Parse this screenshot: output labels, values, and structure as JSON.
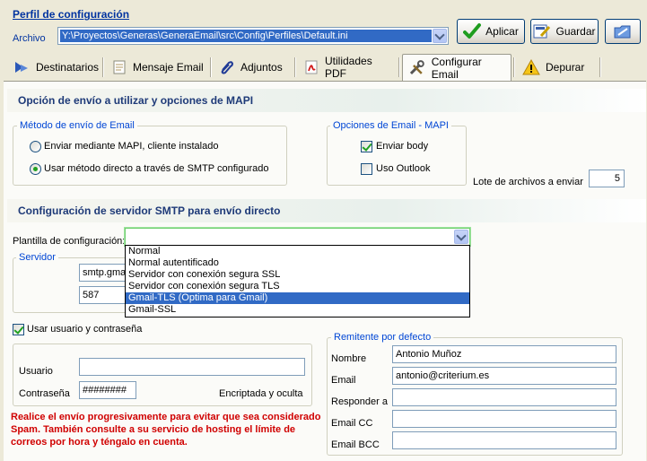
{
  "profile": {
    "title_first": "P",
    "title_rest": "erfil de configuración",
    "archivo_label": "Archivo",
    "file_path": "Y:\\Proyectos\\Generas\\GeneraEmail\\src\\Config\\Perfiles\\Default.ini",
    "apply_label": "Aplicar",
    "save_label": "Guardar"
  },
  "tabs": [
    {
      "label": "Destinatarios",
      "icon": "recipients-icon"
    },
    {
      "label": "Mensaje Email",
      "icon": "message-icon"
    },
    {
      "label": "Adjuntos",
      "icon": "paperclip-icon"
    },
    {
      "label": "Utilidades PDF",
      "icon": "pdf-icon"
    },
    {
      "label": "Configurar Email",
      "icon": "tools-icon"
    },
    {
      "label": "Depurar",
      "icon": "warning-icon"
    }
  ],
  "mapi_section": {
    "header": "Opción de envío a utilizar y opciones de MAPI",
    "method_group": "Método de envío de Email",
    "radio_mapi": "Enviar mediante MAPI, cliente instalado",
    "radio_smtp": "Usar método directo a través de SMTP configurado",
    "options_group": "Opciones de Email - MAPI",
    "enviar_body": "Enviar body",
    "uso_outlook": "Uso Outlook",
    "lote_label": "Lote de archivos a enviar",
    "lote_value": "5"
  },
  "smtp_section": {
    "header": "Configuración de servidor SMTP para envío directo",
    "template_label": "Plantilla de configuración:",
    "template_options": [
      "Normal",
      "Normal autentificado",
      "Servidor con conexión segura SSL",
      "Servidor con conexión segura TLS",
      "Gmail-TLS (Optima para Gmail)",
      "Gmail-SSL"
    ],
    "server_group": "Servidor",
    "server_host": "smtp.gmail",
    "server_port": "587",
    "use_credentials": "Usar usuario y contraseña",
    "user_label": "Usuario",
    "password_label": "Contraseña",
    "password_value": "########",
    "password_note": "Encriptada y oculta"
  },
  "sender": {
    "group": "Remitente por defecto",
    "name_label": "Nombre",
    "name_value": "Antonio Muñoz",
    "email_label": "Email",
    "email_value": "antonio@criterium.es",
    "reply_label": "Responder a",
    "cc_label": "Email CC",
    "bcc_label": "Email BCC"
  },
  "warning": "Realice el envío progresivamente para evitar que sea considerado Spam. También consulte a su servicio de hosting el límite de correos por hora y téngalo en cuenta.",
  "colors": {
    "selection": "#316ac5",
    "header_text": "#1e3a78",
    "warning_text": "#d00000",
    "group_label": "#0046d5"
  }
}
